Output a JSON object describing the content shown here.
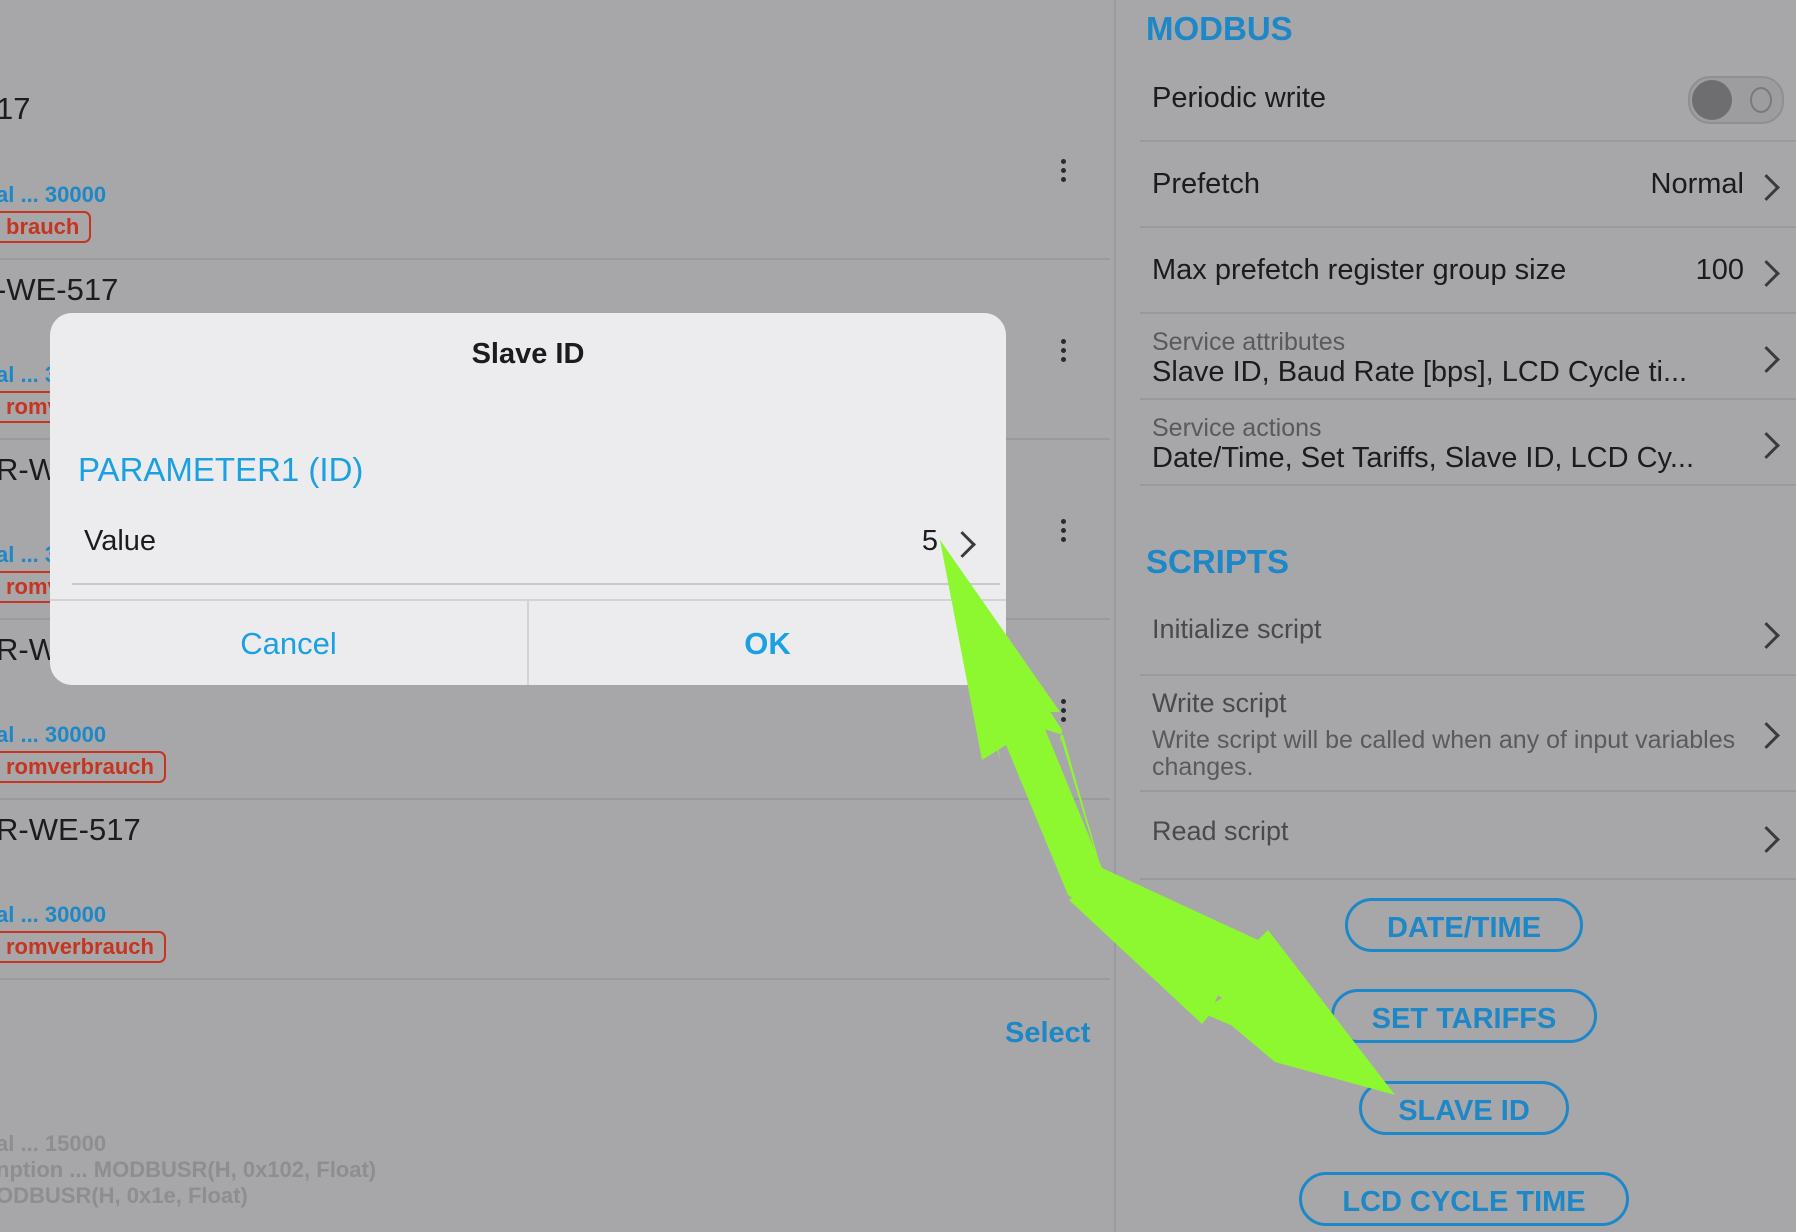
{
  "left_list": {
    "rows": [
      {
        "title": "17",
        "meta": "al ... 30000",
        "tag": "brauch"
      },
      {
        "title": "-WE-517",
        "meta": "al ... 3",
        "tag": "romv"
      },
      {
        "title": "R-W",
        "meta": "al ... 3",
        "tag": "romv"
      },
      {
        "title": "R-W",
        "meta": "al ... 30000",
        "tag": "romverbrauch"
      },
      {
        "title": "R-WE-517",
        "meta": "al ... 30000",
        "tag": "romverbrauch"
      }
    ],
    "select_label": "Select",
    "bottom_lines": [
      "al ... 15000",
      "nption ... MODBUSR(H, 0x102, Float)",
      "ODBUSR(H, 0x1e, Float)"
    ]
  },
  "right_panel": {
    "modbus_title": "MODBUS",
    "periodic_write": {
      "label": "Periodic write",
      "state": "off"
    },
    "prefetch": {
      "label": "Prefetch",
      "value": "Normal"
    },
    "max_prefetch": {
      "label": "Max prefetch register group size",
      "value": "100"
    },
    "service_attributes": {
      "caption": "Service attributes",
      "value": "Slave ID, Baud Rate [bps], LCD Cycle ti..."
    },
    "service_actions": {
      "caption": "Service actions",
      "value": "Date/Time, Set Tariffs, Slave ID, LCD Cy..."
    },
    "scripts_title": "SCRIPTS",
    "initialize_script": {
      "label": "Initialize script"
    },
    "write_script": {
      "label": "Write script",
      "description_line1": "Write script will be called when any of input variables",
      "description_line2": "changes."
    },
    "read_script": {
      "label": "Read script"
    },
    "buttons": [
      "DATE/TIME",
      "SET TARIFFS",
      "SLAVE ID",
      "LCD CYCLE TIME"
    ]
  },
  "dialog": {
    "title": "Slave ID",
    "section": "PARAMETER1 (ID)",
    "value_label": "Value",
    "value": "5",
    "cancel": "Cancel",
    "ok": "OK"
  },
  "colors": {
    "accent": "#1d87c7",
    "dialog_accent": "#1ba1e2",
    "tag_red": "#c7341f",
    "annotation_arrow": "#8df72f",
    "overlay_background": "#a7a7a9"
  }
}
